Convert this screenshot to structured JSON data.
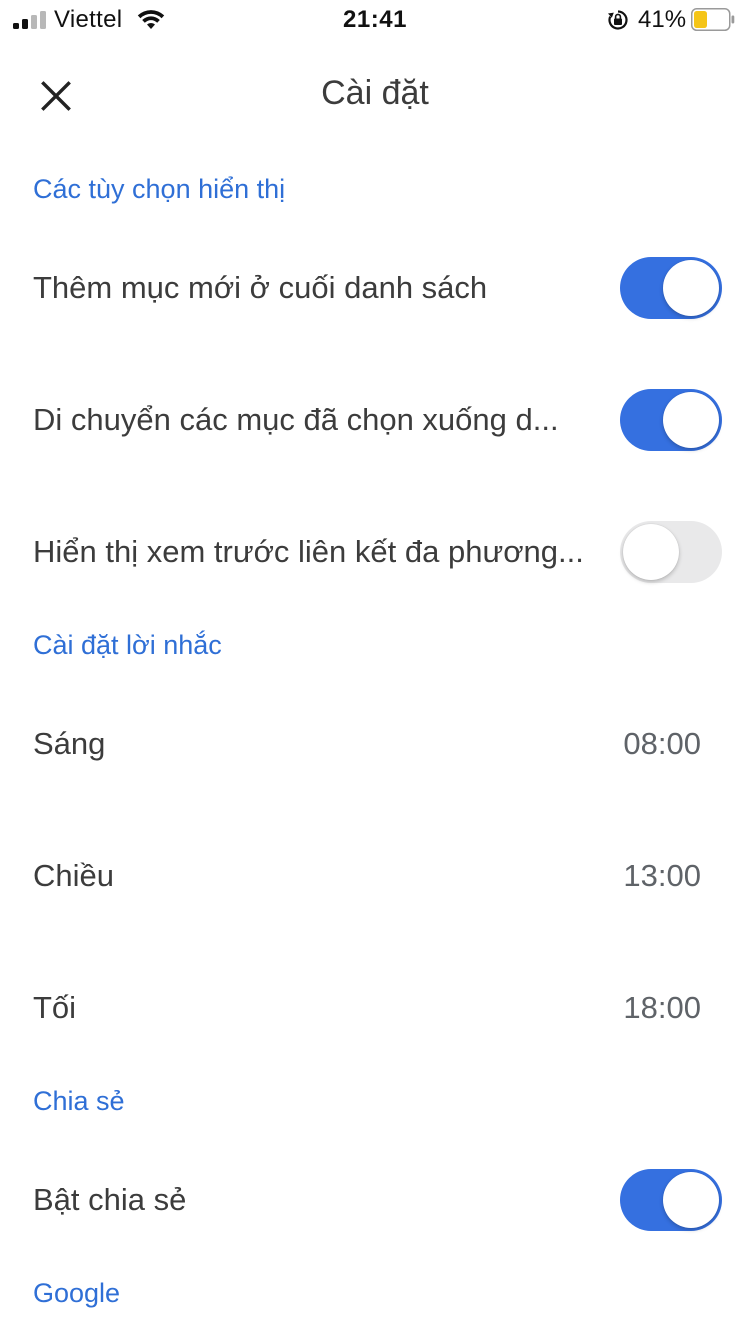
{
  "status_bar": {
    "carrier": "Viettel",
    "time": "21:41",
    "battery_percent": "41%",
    "battery_level": 0.41,
    "battery_color": "#f5c518",
    "icons": [
      "signal-icon",
      "wifi-icon",
      "orientation-lock-icon",
      "battery-icon"
    ]
  },
  "header": {
    "close_icon": "close-icon",
    "title": "Cài đặt"
  },
  "colors": {
    "accent": "#2f6fd6",
    "toggle_on": "#3570e0",
    "toggle_off": "#e9e9ea",
    "text": "#3c3c3c"
  },
  "display_options": {
    "section_title": "Các tùy chọn hiển thị",
    "items": [
      {
        "label": "Thêm mục mới ở cuối danh sách",
        "enabled": true
      },
      {
        "label": "Di chuyển các mục đã chọn xuống d...",
        "enabled": true
      },
      {
        "label": "Hiển thị xem trước liên kết đa phương...",
        "enabled": false
      }
    ]
  },
  "reminder_settings": {
    "section_title": "Cài đặt lời nhắc",
    "items": [
      {
        "label": "Sáng",
        "value": "08:00"
      },
      {
        "label": "Chiều",
        "value": "13:00"
      },
      {
        "label": "Tối",
        "value": "18:00"
      }
    ]
  },
  "sharing": {
    "section_title": "Chia sẻ",
    "items": [
      {
        "label": "Bật chia sẻ",
        "enabled": true
      }
    ]
  },
  "google": {
    "section_title": "Google"
  }
}
